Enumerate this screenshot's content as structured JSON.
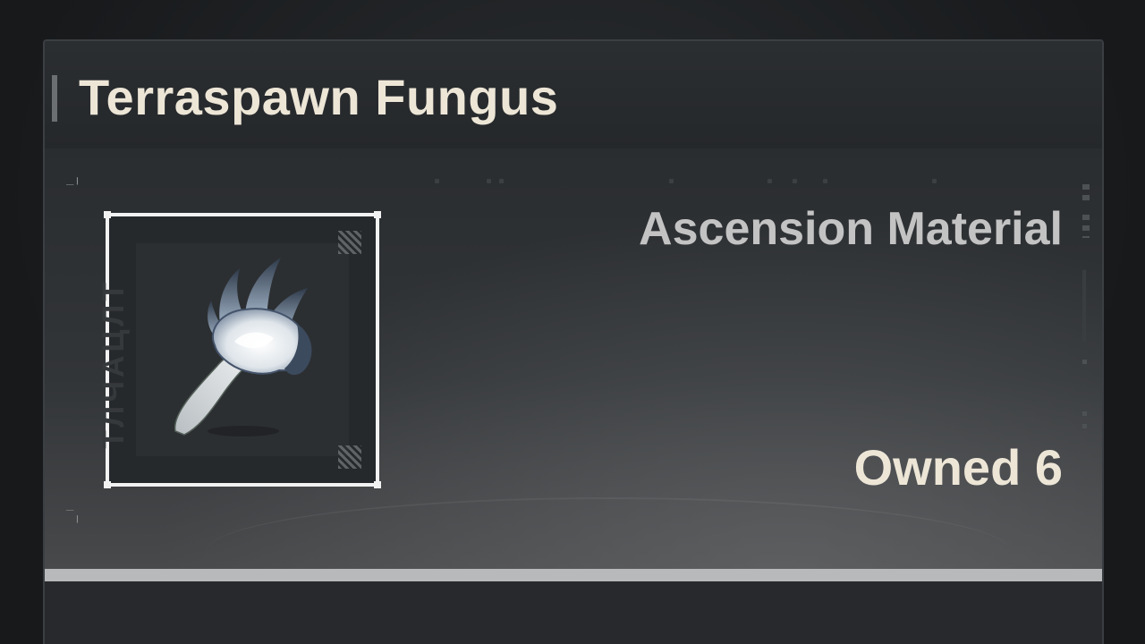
{
  "item": {
    "name": "Terraspawn Fungus",
    "category": "Ascension Material",
    "owned_label": "Owned",
    "owned_count": "6",
    "icon": "terraspawn-fungus-icon",
    "frame_watermark": "ТЛЧАЦЛТ"
  },
  "colors": {
    "title_text": "#ede6d7",
    "category_text": "#c3c3c3",
    "panel_background": "#24272a",
    "frame_border": "#f2f2f2",
    "divider": "#b7b9ba"
  }
}
